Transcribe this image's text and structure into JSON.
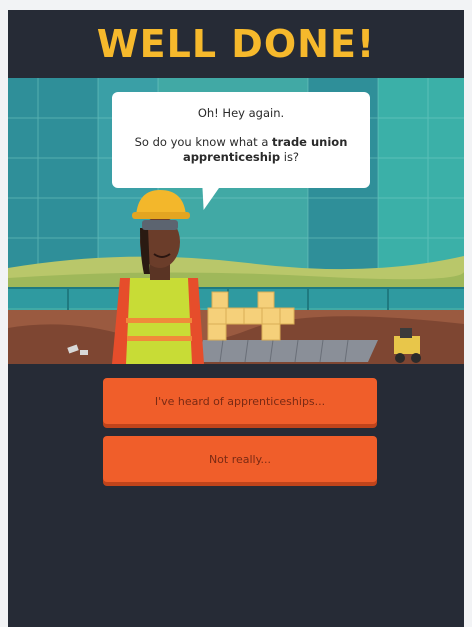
{
  "header": {
    "title": "WELL DONE!"
  },
  "dialog": {
    "line1": "Oh! Hey again.",
    "line2_prefix": "So do you know what a ",
    "line2_bold": "trade union apprenticeship",
    "line2_suffix": " is?"
  },
  "choices": [
    {
      "label": "I've heard of apprenticeships..."
    },
    {
      "label": "Not really..."
    }
  ],
  "colors": {
    "title": "#f6b92c",
    "background": "#262b36",
    "button": "#f05e2a",
    "button_shadow": "#c0441b"
  }
}
